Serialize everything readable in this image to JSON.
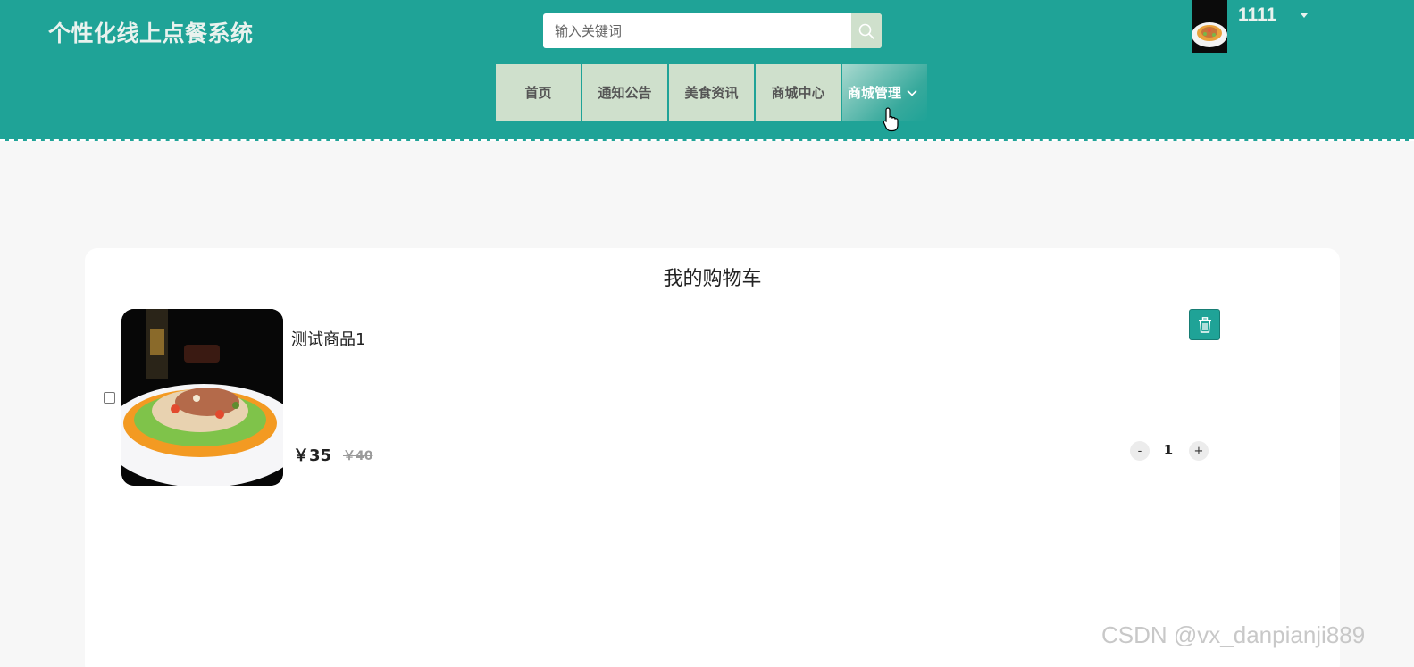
{
  "header": {
    "site_title": "个性化线上点餐系统",
    "search": {
      "placeholder": "输入关键词",
      "value": ""
    },
    "user": {
      "name": "1111"
    }
  },
  "nav": {
    "items": [
      {
        "label": "首页"
      },
      {
        "label": "通知公告"
      },
      {
        "label": "美食资讯"
      },
      {
        "label": "商城中心"
      },
      {
        "label": "商城管理",
        "active": true,
        "has_dropdown": true
      }
    ]
  },
  "cart": {
    "title": "我的购物车",
    "items": [
      {
        "name": "测试商品1",
        "price": "￥35",
        "original_price": "￥40",
        "quantity": "1",
        "checked": false
      }
    ],
    "qty_minus_label": "-",
    "qty_plus_label": "+"
  },
  "colors": {
    "primary": "#1fa397",
    "nav_bg": "#cfe0cc",
    "page_bg": "#f7f7f7"
  },
  "icons": [
    "search-icon",
    "chevron-down-icon",
    "trash-icon",
    "pointer-cursor-icon"
  ],
  "watermark": "CSDN @vx_danpianji889"
}
